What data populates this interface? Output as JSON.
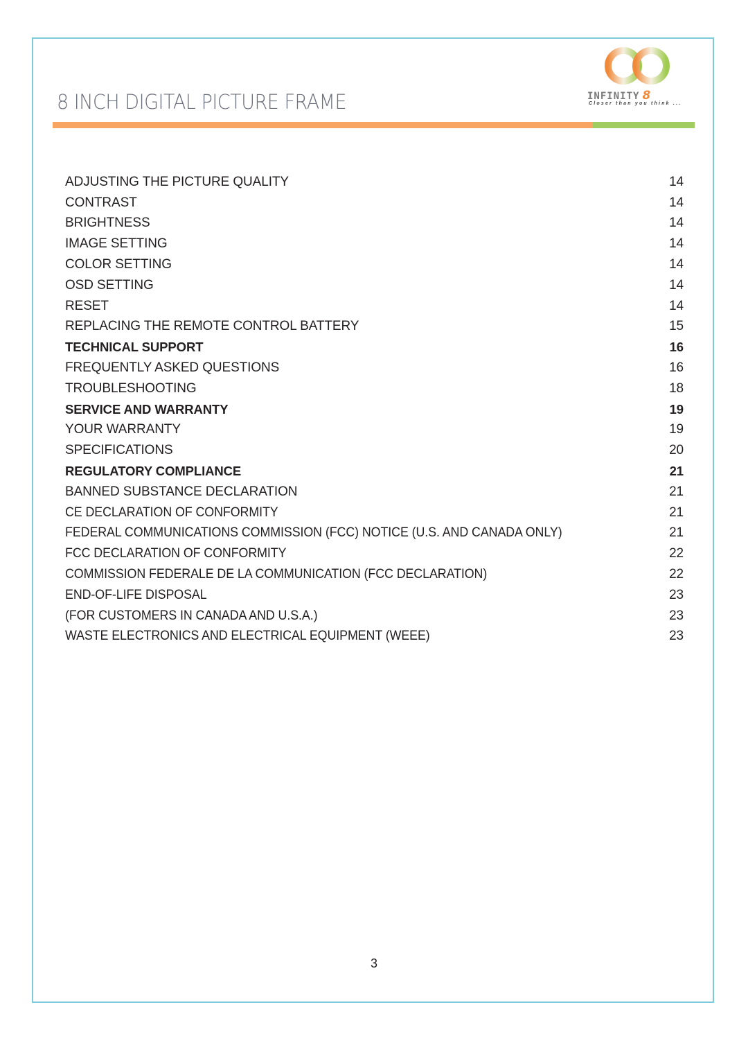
{
  "header": {
    "title": "8 INCH DIGITAL PICTURE FRAME",
    "logo": {
      "wordmark": "INFINITY",
      "wordmark_suffix": "8",
      "tagline": "Closer than you think ...",
      "colors": {
        "orange": "#f08a3a",
        "green": "#9fcb4f"
      }
    },
    "rule_colors": {
      "orange": "#f8a462",
      "green": "#a0cc60"
    }
  },
  "toc": [
    {
      "title": "ADJUSTING THE PICTURE QUALITY",
      "page": "14",
      "bold": false
    },
    {
      "title": "CONTRAST",
      "page": "14",
      "bold": false
    },
    {
      "title": "BRIGHTNESS",
      "page": "14",
      "bold": false
    },
    {
      "title": "IMAGE SETTING",
      "page": "14",
      "bold": false
    },
    {
      "title": "COLOR SETTING",
      "page": "14",
      "bold": false
    },
    {
      "title": "OSD SETTING",
      "page": "14",
      "bold": false
    },
    {
      "title": "RESET",
      "page": "14",
      "bold": false
    },
    {
      "title": "REPLACING THE REMOTE CONTROL BATTERY",
      "page": "15",
      "bold": false
    },
    {
      "title": "TECHNICAL SUPPORT",
      "page": "16",
      "bold": true
    },
    {
      "title": "FREQUENTLY ASKED QUESTIONS",
      "page": "16",
      "bold": false
    },
    {
      "title": "TROUBLESHOOTING",
      "page": "18",
      "bold": false
    },
    {
      "title": "SERVICE AND WARRANTY",
      "page": "19",
      "bold": true
    },
    {
      "title": "YOUR WARRANTY",
      "page": "19",
      "bold": false
    },
    {
      "title": "SPECIFICATIONS",
      "page": "20",
      "bold": false
    },
    {
      "title": "REGULATORY COMPLIANCE",
      "page": "21",
      "bold": true
    },
    {
      "title": "BANNED SUBSTANCE DECLARATION",
      "page": "21",
      "bold": false
    },
    {
      "title": "CE DECLARATION OF CONFORMITY",
      "page": "21",
      "bold": false
    },
    {
      "title": "FEDERAL COMMUNICATIONS COMMISSION (FCC) NOTICE (U.S. AND CANADA ONLY)",
      "page": "21",
      "bold": false
    },
    {
      "title": "FCC DECLARATION OF CONFORMITY",
      "page": "22",
      "bold": false
    },
    {
      "title": "COMMISSION FEDERALE DE LA COMMUNICATION (FCC DECLARATION)",
      "page": "22",
      "bold": false
    },
    {
      "title": "END-OF-LIFE DISPOSAL",
      "page": "23",
      "bold": false
    },
    {
      "title": "(FOR CUSTOMERS IN CANADA AND U.S.A.)",
      "page": "23",
      "bold": false
    },
    {
      "title": "WASTE ELECTRONICS AND ELECTRICAL EQUIPMENT (WEEE)",
      "page": "23",
      "bold": false
    }
  ],
  "footer": {
    "page_number": "3"
  }
}
